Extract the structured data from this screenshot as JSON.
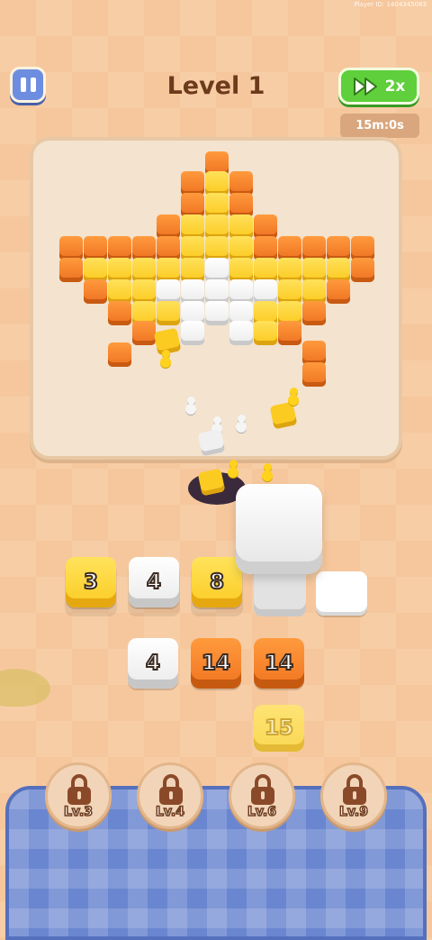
{
  "header": {
    "player_id": "Player ID: 1404345083",
    "title": "Level 1",
    "speed_label": "2x",
    "timer": "15m:0s"
  },
  "slots_row": {
    "tiles": [
      {
        "value": "3",
        "color": "yellow"
      },
      {
        "value": "4",
        "color": "white"
      },
      {
        "value": "8",
        "color": "yellow"
      },
      {
        "value": "",
        "color": "empty"
      },
      {
        "value": "",
        "color": "white-blank"
      }
    ]
  },
  "queue_row": {
    "tiles": [
      {
        "value": "4",
        "color": "white"
      },
      {
        "value": "14",
        "color": "orange"
      },
      {
        "value": "14",
        "color": "orange"
      }
    ],
    "pending": "15"
  },
  "locked_slots": [
    {
      "label": "Lv.3"
    },
    {
      "label": "Lv.4"
    },
    {
      "label": "Lv.6"
    },
    {
      "label": "Lv.9"
    }
  ],
  "colors": {
    "orange": "#f07420",
    "yellow": "#fbcb22",
    "white": "#ffffff",
    "accent_green": "#5fcf3c",
    "accent_blue": "#6d8ee0"
  },
  "icons": {
    "pause": "pause-icon",
    "speed": "fast-forward-icon",
    "lock": "lock-icon"
  }
}
